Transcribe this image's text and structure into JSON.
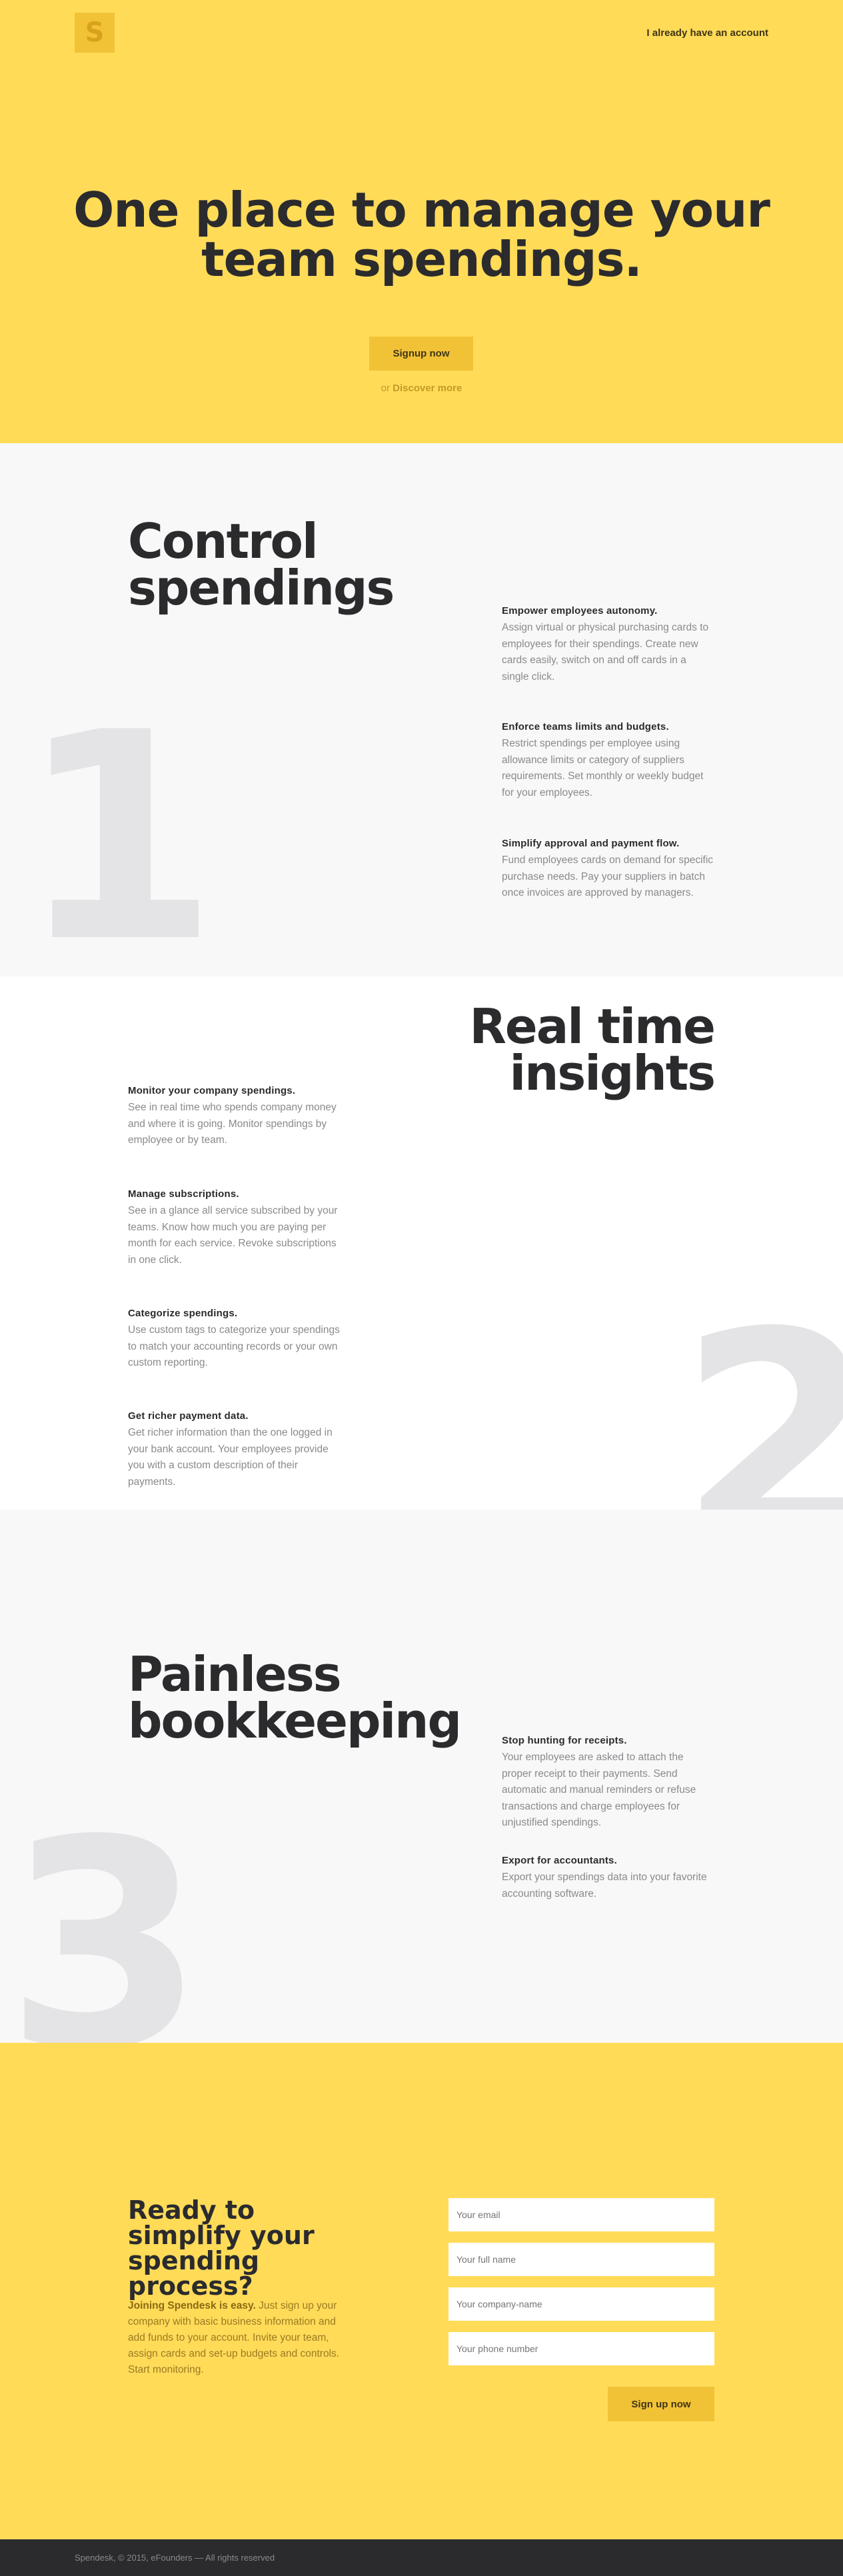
{
  "header": {
    "logo_letter": "S",
    "login_link": "I already have an account"
  },
  "hero": {
    "title_line1": "One place to manage your",
    "title_line2": "team spendings.",
    "signup_button": "Signup now",
    "or_text": "or",
    "discover_link": "Discover more"
  },
  "sections": [
    {
      "number": "1",
      "title_line1": "Control",
      "title_line2": "spendings",
      "features": [
        {
          "title": "Empower employees autonomy.",
          "text": "Assign virtual or physical purchasing cards to employees for their spendings. Create new cards easily, switch on and off cards in a single click."
        },
        {
          "title": "Enforce teams limits and budgets.",
          "text": "Restrict spendings per employee using allowance limits or category of suppliers requirements. Set monthly or weekly budget for your employees."
        },
        {
          "title": "Simplify approval and payment flow.",
          "text": "Fund employees cards on demand for specific purchase needs. Pay your suppliers in batch once invoices are approved by managers."
        }
      ]
    },
    {
      "number": "2",
      "title_line1": "Real time",
      "title_line2": "insights",
      "features": [
        {
          "title": "Monitor your company spendings.",
          "text": "See in real time who spends company money and where it is going. Monitor spendings by employee or by team."
        },
        {
          "title": "Manage subscriptions.",
          "text": "See in a glance all service subscribed by your teams. Know how much you are paying per month for each service. Revoke subscriptions in one click."
        },
        {
          "title": "Categorize spendings.",
          "text": "Use custom tags to categorize your spendings to match your accounting records or your own custom reporting."
        },
        {
          "title": "Get richer payment data.",
          "text": "Get richer information than the one logged in your bank account. Your employees provide you with a custom description of their payments."
        }
      ]
    },
    {
      "number": "3",
      "title_line1": "Painless",
      "title_line2": "bookkeeping",
      "features": [
        {
          "title": "Stop hunting for receipts.",
          "text": "Your employees are asked to attach the proper receipt to their payments. Send automatic and manual reminders or refuse transactions and charge employees for unjustified spendings."
        },
        {
          "title": "Export for accountants.",
          "text": "Export your spendings data into your favorite accounting software."
        }
      ]
    }
  ],
  "cta": {
    "title": "Ready to simplify your spending process?",
    "lead_bold": "Joining Spendesk is easy.",
    "lead_text": " Just sign up your company with basic business information and add funds to your account. Invite your team, assign cards and set-up budgets and controls. Start monitoring.",
    "email_placeholder": "Your email",
    "name_placeholder": "Your full name",
    "company_placeholder": "Your company-name",
    "phone_placeholder": "Your phone number",
    "submit_button": "Sign up now"
  },
  "footer": {
    "text": "Spendesk, © 2015, eFounders — All rights reserved"
  },
  "colors": {
    "brand_yellow": "#ffdb58",
    "button_yellow": "#f2c236",
    "dark": "#2b2b2e",
    "muted_text": "#8a8a8e"
  }
}
